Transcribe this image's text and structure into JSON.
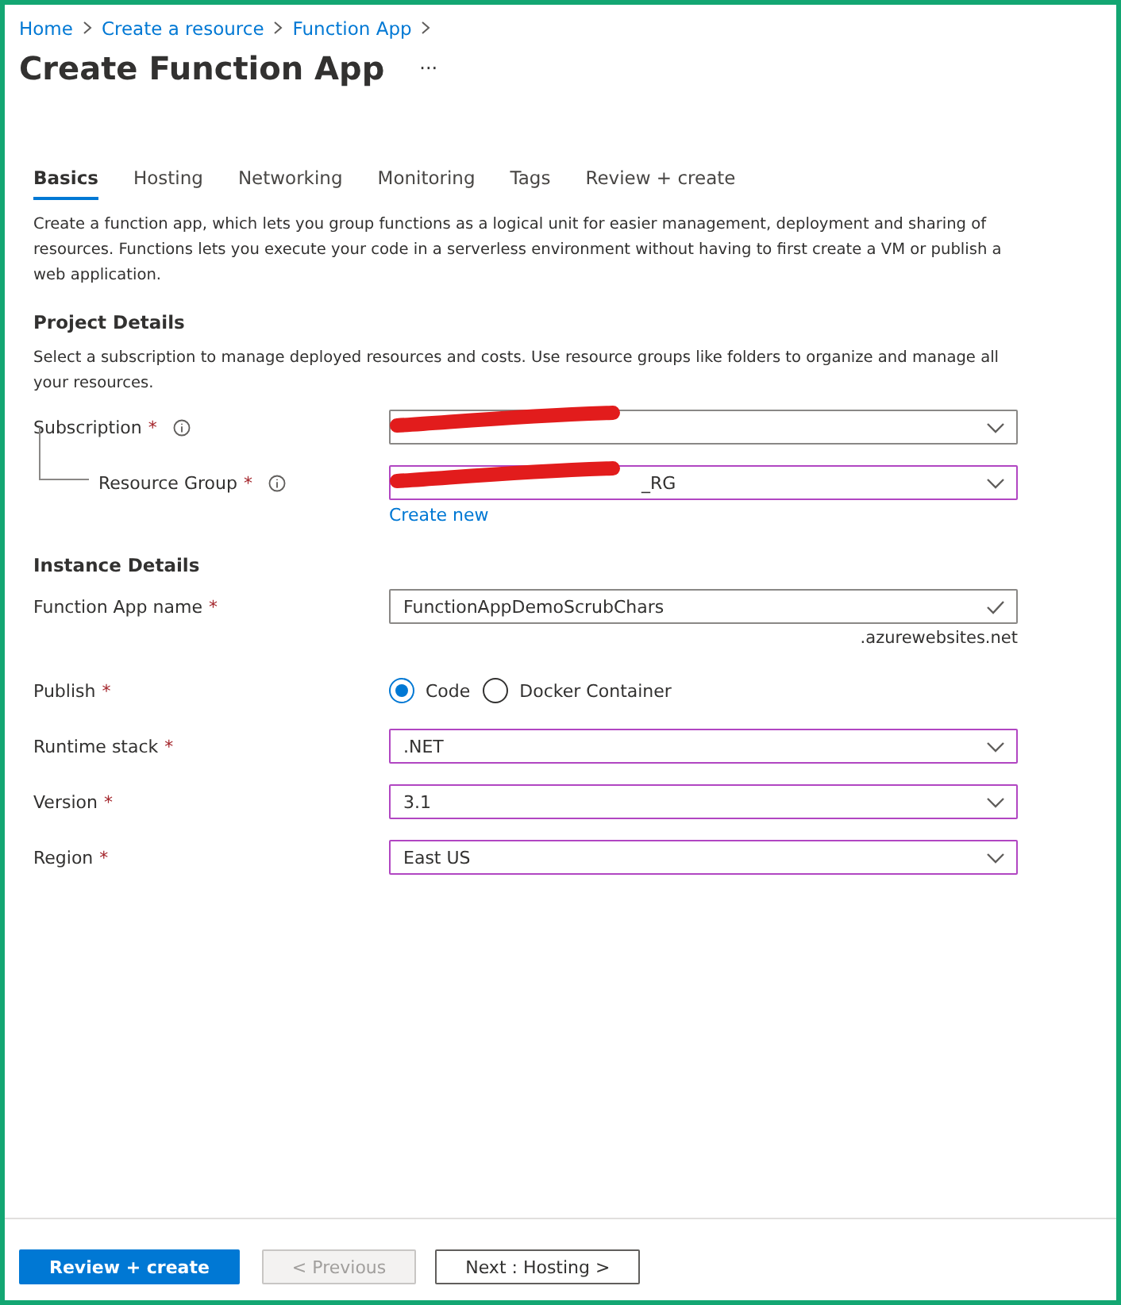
{
  "breadcrumb": [
    "Home",
    "Create a resource",
    "Function App"
  ],
  "title": "Create Function App",
  "more": "···",
  "tabs": [
    {
      "label": "Basics",
      "selected": true
    },
    {
      "label": "Hosting",
      "selected": false
    },
    {
      "label": "Networking",
      "selected": false
    },
    {
      "label": "Monitoring",
      "selected": false
    },
    {
      "label": "Tags",
      "selected": false
    },
    {
      "label": "Review + create",
      "selected": false
    }
  ],
  "intro": "Create a function app, which lets you group functions as a logical unit for easier management, deployment and sharing of resources. Functions lets you execute your code in a serverless environment without having to first create a VM or publish a web application.",
  "sections": [
    {
      "heading": "Project Details",
      "description": "Select a subscription to manage deployed resources and costs. Use resource groups like folders to organize and manage all your resources.",
      "fields": [
        {
          "kind": "select",
          "label": "Subscription",
          "required": "*",
          "info": true,
          "redacted": true,
          "dirty": false
        },
        {
          "kind": "select",
          "label": "Resource Group",
          "required": "*",
          "info": true,
          "nested": true,
          "redacted": true,
          "value": "_RG",
          "dirty": true,
          "link": "Create new"
        }
      ]
    },
    {
      "heading": "Instance Details",
      "fields": [
        {
          "kind": "text",
          "label": "Function App name",
          "required": "*",
          "value": "FunctionAppDemoScrubChars",
          "valid": true,
          "dirty": false,
          "suffix": ".azurewebsites.net"
        },
        {
          "kind": "radio",
          "label": "Publish",
          "required": "*",
          "options": [
            {
              "label": "Code",
              "selected": true
            },
            {
              "label": "Docker Container",
              "selected": false
            }
          ]
        },
        {
          "kind": "select",
          "label": "Runtime stack",
          "required": "*",
          "value": ".NET",
          "dirty": true
        },
        {
          "kind": "select",
          "label": "Version",
          "required": "*",
          "value": "3.1",
          "dirty": true
        },
        {
          "kind": "select",
          "label": "Region",
          "required": "*",
          "value": "East US",
          "dirty": true
        }
      ]
    }
  ],
  "footer": [
    {
      "label": "Review + create",
      "kind": "primary",
      "disabled": false
    },
    {
      "label": "< Previous",
      "kind": "secondary",
      "disabled": true
    },
    {
      "label": "Next : Hosting >",
      "kind": "secondary",
      "disabled": false
    }
  ]
}
